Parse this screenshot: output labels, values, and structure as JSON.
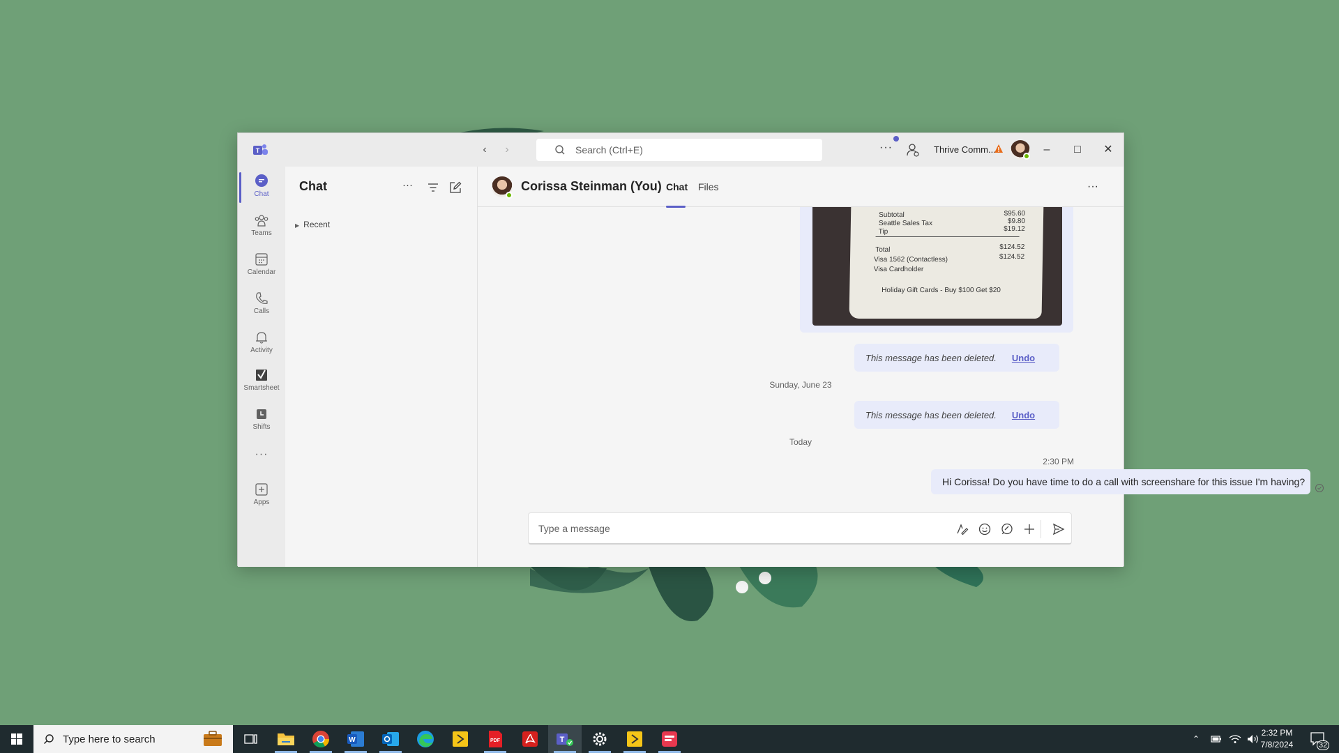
{
  "titlebar": {
    "search_placeholder": "Search (Ctrl+E)",
    "org_name": "Thrive Comm...",
    "more_label": "···"
  },
  "rail": {
    "items": [
      {
        "label": "Chat",
        "icon": "chat-icon"
      },
      {
        "label": "Teams",
        "icon": "teams-icon"
      },
      {
        "label": "Calendar",
        "icon": "calendar-icon"
      },
      {
        "label": "Calls",
        "icon": "phone-icon"
      },
      {
        "label": "Activity",
        "icon": "bell-icon"
      },
      {
        "label": "Smartsheet",
        "icon": "smartsheet-icon"
      },
      {
        "label": "Shifts",
        "icon": "shifts-icon"
      },
      {
        "label": "···",
        "icon": "more-icon"
      },
      {
        "label": "Apps",
        "icon": "apps-icon"
      }
    ]
  },
  "chatlist": {
    "title": "Chat",
    "more_label": "···",
    "section": "Recent"
  },
  "chat": {
    "contact_name": "Corissa Steinman (You)",
    "tabs": [
      "Chat",
      "Files"
    ],
    "more_label": "···",
    "receipt": {
      "lines": [
        {
          "label": "Subtotal",
          "value": "$95.60"
        },
        {
          "label": "Seattle Sales Tax",
          "value": "$9.80"
        },
        {
          "label": "Tip",
          "value": "$19.12"
        },
        {
          "label": "Total",
          "value": "$124.52"
        },
        {
          "label": "Visa 1562 (Contactless)",
          "value": "$124.52"
        },
        {
          "label": "Visa Cardholder",
          "value": ""
        }
      ],
      "footer": "Holiday Gift Cards - Buy $100 Get $20"
    },
    "deleted_text": "This message has been deleted.",
    "undo_label": "Undo",
    "date_divider_1": "Sunday, June 23",
    "date_divider_2": "Today",
    "message_time": "2:30 PM",
    "message_text": "Hi Corissa! Do you have time to do a call with screenshare for this issue I'm having?",
    "compose_placeholder": "Type a message"
  },
  "taskbar": {
    "search_placeholder": "Type here to search",
    "time": "2:32 PM",
    "date": "7/8/2024",
    "notification_count": "32",
    "apps": [
      "task-view-icon",
      "file-explorer-icon",
      "chrome-icon",
      "word-icon",
      "outlook-icon",
      "edge-icon",
      "app-yellow-icon",
      "pdf-red-icon",
      "acrobat-icon",
      "teams-icon",
      "settings-icon",
      "app-yellow2-icon",
      "app-red-icon"
    ]
  },
  "colors": {
    "accent": "#5b5fc7",
    "wallpaper": "#6fa077",
    "bubble": "#e8ebfa",
    "presence": "#6bb700"
  }
}
